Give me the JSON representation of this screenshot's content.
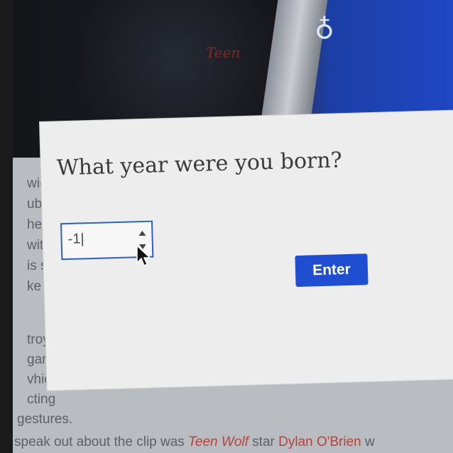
{
  "dialog": {
    "question": "What year were you born?",
    "year_input_value": "-1|",
    "enter_label": "Enter"
  },
  "background": {
    "logo_glyph": "♁",
    "scribble": "Teen",
    "article_left_fragments": [
      "wic",
      "ube",
      "he",
      "wit",
      "is st",
      "ke to",
      "troy",
      "gar",
      "vhicl",
      "cting"
    ],
    "line_gestures": "gestures.",
    "line_bottom_start": "speak out about the clip was ",
    "line_bottom_italic": "Teen Wolf",
    "line_bottom_mid": " star ",
    "line_bottom_name": "Dylan O'Brien",
    "line_bottom_end": " w"
  },
  "colors": {
    "accent_blue": "#1f4fd0",
    "input_border": "#2c5fc6",
    "dialog_bg": "#ededee"
  }
}
